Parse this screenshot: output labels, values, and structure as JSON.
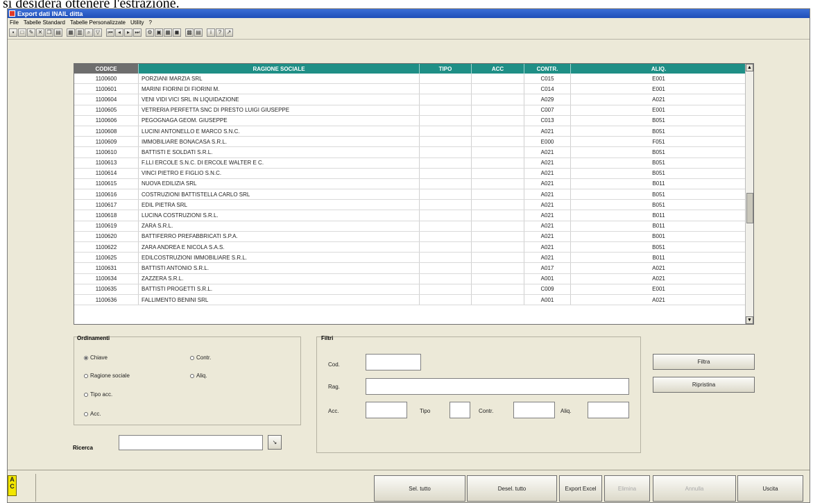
{
  "caption": "si desidera ottenere l'estrazione.",
  "window": {
    "title": "Export dati INAIL ditta",
    "menu": [
      "File",
      "Tabelle Standard",
      "Tabelle Personalizzate",
      "Utility",
      "?"
    ]
  },
  "grid": {
    "headers": [
      "CODICE",
      "RAGIONE SOCIALE",
      "TIPO",
      "ACC",
      "CONTR.",
      "ALIQ."
    ],
    "rows": [
      [
        "1100600",
        "PORZIANI MARZIA SRL",
        "",
        "",
        "C015",
        "E001"
      ],
      [
        "1100601",
        "MARINI FIORINI DI FIORINI M.",
        "",
        "",
        "C014",
        "E001"
      ],
      [
        "1100604",
        "VENI VIDI VICI SRL IN LIQUIDAZIONE",
        "",
        "",
        "A029",
        "A021"
      ],
      [
        "1100605",
        "VETRERIA PERFETTA SNC DI PRESTO LUIGI GIUSEPPE",
        "",
        "",
        "C007",
        "E001"
      ],
      [
        "1100606",
        "PEGOGNAGA GEOM. GIUSEPPE",
        "",
        "",
        "C013",
        "B051"
      ],
      [
        "1100608",
        "LUCINI ANTONELLO E MARCO S.N.C.",
        "",
        "",
        "A021",
        "B051"
      ],
      [
        "1100609",
        "IMMOBILIARE BONACASA S.R.L.",
        "",
        "",
        "E000",
        "F051"
      ],
      [
        "1100610",
        "BATTISTI E SOLDATI S.R.L.",
        "",
        "",
        "A021",
        "B051"
      ],
      [
        "1100613",
        "F.LLI ERCOLE S.N.C. DI ERCOLE WALTER E C.",
        "",
        "",
        "A021",
        "B051"
      ],
      [
        "1100614",
        "VINCI PIETRO E FIGLIO S.N.C.",
        "",
        "",
        "A021",
        "B051"
      ],
      [
        "1100615",
        "NUOVA EDILIZIA SRL",
        "",
        "",
        "A021",
        "B011"
      ],
      [
        "1100616",
        "COSTRUZIONI BATTISTELLA CARLO SRL",
        "",
        "",
        "A021",
        "B051"
      ],
      [
        "1100617",
        "EDIL PIETRA SRL",
        "",
        "",
        "A021",
        "B051"
      ],
      [
        "1100618",
        "LUCINA COSTRUZIONI S.R.L.",
        "",
        "",
        "A021",
        "B011"
      ],
      [
        "1100619",
        "ZARA S.R.L.",
        "",
        "",
        "A021",
        "B011"
      ],
      [
        "1100620",
        "BATTIFERRO PREFABBRICATI S.P.A.",
        "",
        "",
        "A021",
        "B001"
      ],
      [
        "1100622",
        "ZARA ANDREA E NICOLA S.A.S.",
        "",
        "",
        "A021",
        "B051"
      ],
      [
        "1100625",
        "EDILCOSTRUZIONI IMMOBILIARE S.R.L.",
        "",
        "",
        "A021",
        "B011"
      ],
      [
        "1100631",
        "BATTISTI ANTONIO S.R.L.",
        "",
        "",
        "A017",
        "A021"
      ],
      [
        "1100634",
        "ZAZZERA S.R.L.",
        "",
        "",
        "A001",
        "A021"
      ],
      [
        "1100635",
        "BATTISTI PROGETTI S.R.L.",
        "",
        "",
        "C009",
        "E001"
      ],
      [
        "1100636",
        "FALLIMENTO BENINI SRL",
        "",
        "",
        "A001",
        "A021"
      ]
    ]
  },
  "ordinamenti": {
    "title": "Ordinamenti",
    "options": [
      "Chiave",
      "Ragione sociale",
      "Tipo acc.",
      "Acc.",
      "Contr.",
      "Aliq."
    ],
    "selected": "Chiave"
  },
  "ricerca": {
    "label": "Ricerca"
  },
  "filtri": {
    "title": "Filtri",
    "cod": "Cod.",
    "rag": "Rag.",
    "acc": "Acc.",
    "tipo": "Tipo",
    "contr": "Contr.",
    "aliq": "Aliq.",
    "filtra": "Filtra",
    "ripristina": "Ripristina"
  },
  "bottom": {
    "logo": "A C",
    "buttons": [
      "Sel. tutto",
      "Desel. tutto",
      "Export Excel",
      "Elimina",
      "Annulla",
      "Uscita"
    ]
  }
}
